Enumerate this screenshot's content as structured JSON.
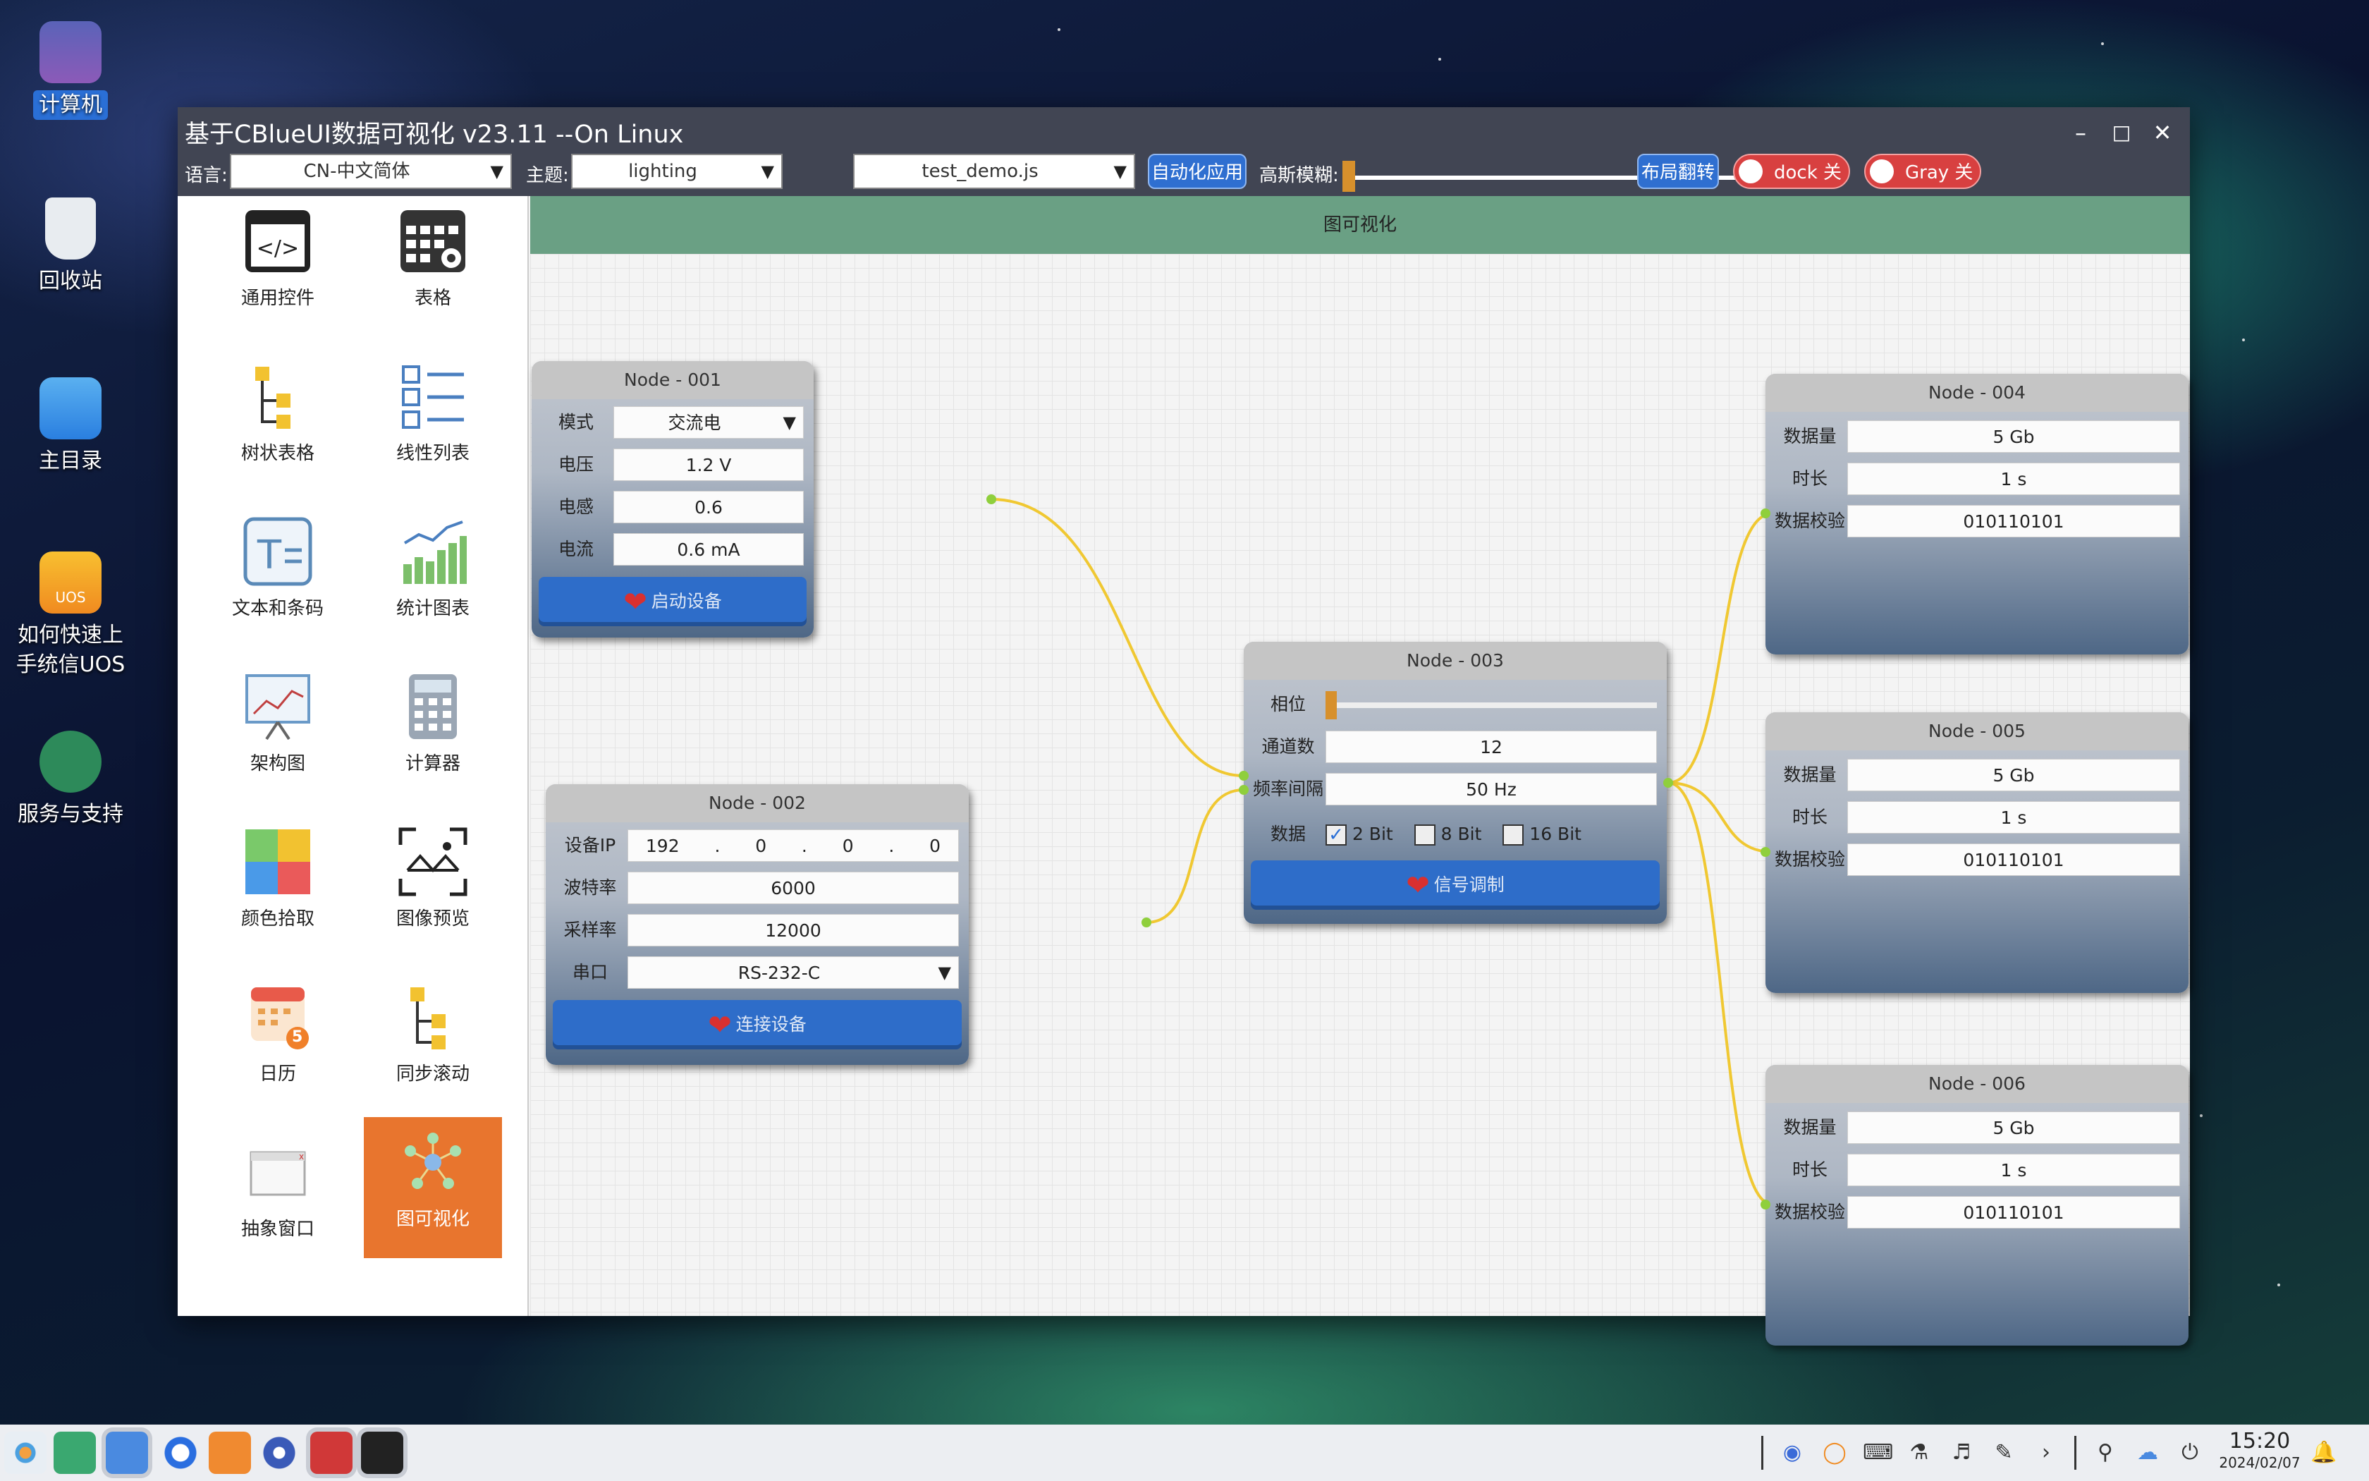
{
  "desktop": {
    "icons": [
      {
        "label": "计算机",
        "icon": "computer-icon"
      },
      {
        "label": "回收站",
        "icon": "trash-icon"
      },
      {
        "label": "主目录",
        "icon": "home-folder-icon"
      },
      {
        "label": "如何快速上手统信UOS",
        "icon": "uos-guide-icon",
        "badge": "UOS"
      },
      {
        "label": "服务与支持",
        "icon": "support-icon"
      }
    ]
  },
  "window": {
    "title": "基于CBlueUI数据可视化 v23.11 --On Linux"
  },
  "toolbar": {
    "lang_label": "语言:",
    "lang_value": "CN-中文简体",
    "theme_label": "主题:",
    "theme_value": "lighting",
    "script_value": "test_demo.js",
    "auto_apply": "自动化应用",
    "blur_label": "高斯模糊:",
    "blur_value": 0,
    "layout_flip": "布局翻转",
    "dock_toggle": "dock 关闭",
    "gray_toggle": "Gray 关闭"
  },
  "sidebar": {
    "items": [
      {
        "label": "通用控件",
        "icon": "code-icon"
      },
      {
        "label": "表格",
        "icon": "table-gear-icon"
      },
      {
        "label": "树状表格",
        "icon": "tree-table-icon"
      },
      {
        "label": "线性列表",
        "icon": "linear-list-icon"
      },
      {
        "label": "文本和条码",
        "icon": "text-barcode-icon"
      },
      {
        "label": "统计图表",
        "icon": "stat-chart-icon"
      },
      {
        "label": "架构图",
        "icon": "architecture-icon"
      },
      {
        "label": "计算器",
        "icon": "calculator-icon"
      },
      {
        "label": "颜色拾取",
        "icon": "color-picker-icon"
      },
      {
        "label": "图像预览",
        "icon": "image-preview-icon"
      },
      {
        "label": "日历",
        "icon": "calendar-icon",
        "badge": "5"
      },
      {
        "label": "同步滚动",
        "icon": "sync-scroll-icon"
      },
      {
        "label": "抽象窗口",
        "icon": "abstract-window-icon"
      },
      {
        "label": "图可视化",
        "icon": "graph-icon",
        "active": true
      }
    ]
  },
  "graph": {
    "header": "图可视化"
  },
  "nodes": {
    "n1": {
      "title": "Node - 001",
      "mode_label": "模式",
      "mode_value": "交流电",
      "voltage_label": "电压",
      "voltage_value": "1.2 V",
      "inductance_label": "电感",
      "inductance_value": "0.6",
      "current_label": "电流",
      "current_value": "0.6 mA",
      "button": "启动设备"
    },
    "n2": {
      "title": "Node - 002",
      "ip_label": "设备IP",
      "ip": [
        "192",
        ".",
        "0",
        ".",
        "0",
        ".",
        "0"
      ],
      "baud_label": "波特率",
      "baud_value": "6000",
      "sample_label": "采样率",
      "sample_value": "12000",
      "port_label": "串口",
      "port_value": "RS-232-C",
      "button": "连接设备"
    },
    "n3": {
      "title": "Node - 003",
      "phase_label": "相位",
      "phase_value": 0,
      "channels_label": "通道数",
      "channels_value": "12",
      "freq_label": "频率间隔",
      "freq_value": "50 Hz",
      "data_label": "数据",
      "opt1": "2 Bit",
      "opt2": "8 Bit",
      "opt3": "16 Bit",
      "opt1_checked": true,
      "button": "信号调制"
    },
    "n4": {
      "title": "Node - 004",
      "amount_label": "数据量",
      "amount_value": "5 Gb",
      "duration_label": "时长",
      "duration_value": "1 s",
      "check_label": "数据校验",
      "check_value": "010110101"
    },
    "n5": {
      "title": "Node - 005",
      "amount_label": "数据量",
      "amount_value": "5 Gb",
      "duration_label": "时长",
      "duration_value": "1 s",
      "check_label": "数据校验",
      "check_value": "010110101"
    },
    "n6": {
      "title": "Node - 006",
      "amount_label": "数据量",
      "amount_value": "5 Gb",
      "duration_label": "时长",
      "duration_value": "1 s",
      "check_label": "数据校验",
      "check_value": "010110101"
    }
  },
  "taskbar": {
    "time": "15:20",
    "date": "2024/02/07"
  },
  "colors": {
    "accent": "#2f6fd0",
    "active_nav": "#e8752e",
    "edge": "#f0c832",
    "port": "#8fcf3c",
    "toggle_off": "#d84040"
  }
}
